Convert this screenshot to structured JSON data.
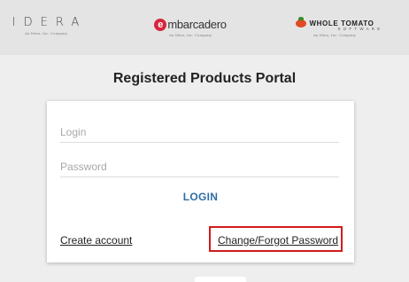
{
  "brands": {
    "idera": {
      "name": "IDERA",
      "tagline": "An Idera, Inc. Company"
    },
    "embarcadero": {
      "name": "mbarcadero",
      "initial": "e",
      "tagline": "An Idera, Inc. Company"
    },
    "whole_tomato": {
      "name": "WHOLE TOMATO",
      "sub": "SOFTWARE",
      "tagline": "An Idera, Inc. Company"
    }
  },
  "page": {
    "title": "Registered Products Portal"
  },
  "form": {
    "login_placeholder": "Login",
    "password_placeholder": "Password",
    "login_button": "LOGIN",
    "create_account": "Create account",
    "change_password": "Change/Forgot Password"
  },
  "colors": {
    "accent": "#2f6ea3",
    "highlight": "#d21b1b",
    "brand_red": "#d6263b"
  }
}
